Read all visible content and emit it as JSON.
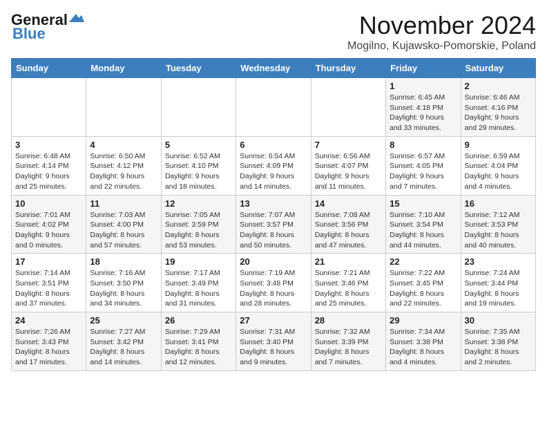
{
  "logo": {
    "general": "General",
    "blue": "Blue"
  },
  "title": "November 2024",
  "location": "Mogilno, Kujawsko-Pomorskie, Poland",
  "weekdays": [
    "Sunday",
    "Monday",
    "Tuesday",
    "Wednesday",
    "Thursday",
    "Friday",
    "Saturday"
  ],
  "weeks": [
    [
      {
        "day": "",
        "info": ""
      },
      {
        "day": "",
        "info": ""
      },
      {
        "day": "",
        "info": ""
      },
      {
        "day": "",
        "info": ""
      },
      {
        "day": "",
        "info": ""
      },
      {
        "day": "1",
        "info": "Sunrise: 6:45 AM\nSunset: 4:18 PM\nDaylight: 9 hours\nand 33 minutes."
      },
      {
        "day": "2",
        "info": "Sunrise: 6:46 AM\nSunset: 4:16 PM\nDaylight: 9 hours\nand 29 minutes."
      }
    ],
    [
      {
        "day": "3",
        "info": "Sunrise: 6:48 AM\nSunset: 4:14 PM\nDaylight: 9 hours\nand 25 minutes."
      },
      {
        "day": "4",
        "info": "Sunrise: 6:50 AM\nSunset: 4:12 PM\nDaylight: 9 hours\nand 22 minutes."
      },
      {
        "day": "5",
        "info": "Sunrise: 6:52 AM\nSunset: 4:10 PM\nDaylight: 9 hours\nand 18 minutes."
      },
      {
        "day": "6",
        "info": "Sunrise: 6:54 AM\nSunset: 4:09 PM\nDaylight: 9 hours\nand 14 minutes."
      },
      {
        "day": "7",
        "info": "Sunrise: 6:56 AM\nSunset: 4:07 PM\nDaylight: 9 hours\nand 11 minutes."
      },
      {
        "day": "8",
        "info": "Sunrise: 6:57 AM\nSunset: 4:05 PM\nDaylight: 9 hours\nand 7 minutes."
      },
      {
        "day": "9",
        "info": "Sunrise: 6:59 AM\nSunset: 4:04 PM\nDaylight: 9 hours\nand 4 minutes."
      }
    ],
    [
      {
        "day": "10",
        "info": "Sunrise: 7:01 AM\nSunset: 4:02 PM\nDaylight: 9 hours\nand 0 minutes."
      },
      {
        "day": "11",
        "info": "Sunrise: 7:03 AM\nSunset: 4:00 PM\nDaylight: 8 hours\nand 57 minutes."
      },
      {
        "day": "12",
        "info": "Sunrise: 7:05 AM\nSunset: 3:59 PM\nDaylight: 8 hours\nand 53 minutes."
      },
      {
        "day": "13",
        "info": "Sunrise: 7:07 AM\nSunset: 3:57 PM\nDaylight: 8 hours\nand 50 minutes."
      },
      {
        "day": "14",
        "info": "Sunrise: 7:08 AM\nSunset: 3:56 PM\nDaylight: 8 hours\nand 47 minutes."
      },
      {
        "day": "15",
        "info": "Sunrise: 7:10 AM\nSunset: 3:54 PM\nDaylight: 8 hours\nand 44 minutes."
      },
      {
        "day": "16",
        "info": "Sunrise: 7:12 AM\nSunset: 3:53 PM\nDaylight: 8 hours\nand 40 minutes."
      }
    ],
    [
      {
        "day": "17",
        "info": "Sunrise: 7:14 AM\nSunset: 3:51 PM\nDaylight: 8 hours\nand 37 minutes."
      },
      {
        "day": "18",
        "info": "Sunrise: 7:16 AM\nSunset: 3:50 PM\nDaylight: 8 hours\nand 34 minutes."
      },
      {
        "day": "19",
        "info": "Sunrise: 7:17 AM\nSunset: 3:49 PM\nDaylight: 8 hours\nand 31 minutes."
      },
      {
        "day": "20",
        "info": "Sunrise: 7:19 AM\nSunset: 3:48 PM\nDaylight: 8 hours\nand 28 minutes."
      },
      {
        "day": "21",
        "info": "Sunrise: 7:21 AM\nSunset: 3:46 PM\nDaylight: 8 hours\nand 25 minutes."
      },
      {
        "day": "22",
        "info": "Sunrise: 7:22 AM\nSunset: 3:45 PM\nDaylight: 8 hours\nand 22 minutes."
      },
      {
        "day": "23",
        "info": "Sunrise: 7:24 AM\nSunset: 3:44 PM\nDaylight: 8 hours\nand 19 minutes."
      }
    ],
    [
      {
        "day": "24",
        "info": "Sunrise: 7:26 AM\nSunset: 3:43 PM\nDaylight: 8 hours\nand 17 minutes."
      },
      {
        "day": "25",
        "info": "Sunrise: 7:27 AM\nSunset: 3:42 PM\nDaylight: 8 hours\nand 14 minutes."
      },
      {
        "day": "26",
        "info": "Sunrise: 7:29 AM\nSunset: 3:41 PM\nDaylight: 8 hours\nand 12 minutes."
      },
      {
        "day": "27",
        "info": "Sunrise: 7:31 AM\nSunset: 3:40 PM\nDaylight: 8 hours\nand 9 minutes."
      },
      {
        "day": "28",
        "info": "Sunrise: 7:32 AM\nSunset: 3:39 PM\nDaylight: 8 hours\nand 7 minutes."
      },
      {
        "day": "29",
        "info": "Sunrise: 7:34 AM\nSunset: 3:38 PM\nDaylight: 8 hours\nand 4 minutes."
      },
      {
        "day": "30",
        "info": "Sunrise: 7:35 AM\nSunset: 3:38 PM\nDaylight: 8 hours\nand 2 minutes."
      }
    ]
  ]
}
